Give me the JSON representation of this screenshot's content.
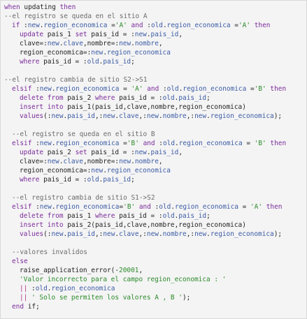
{
  "editor": {
    "lines": [
      {
        "indent": 0,
        "tokens": [
          [
            "kw",
            "when"
          ],
          [
            "tx",
            " updating "
          ],
          [
            "kw",
            "then"
          ]
        ]
      },
      {
        "indent": 0,
        "tokens": [
          [
            "cm",
            "--el registro se queda en el sitio A"
          ]
        ]
      },
      {
        "indent": 1,
        "tokens": [
          [
            "kw",
            "if"
          ],
          [
            "tx",
            " :"
          ],
          [
            "id",
            "new"
          ],
          [
            "tx",
            "."
          ],
          [
            "id",
            "region_economica"
          ],
          [
            "tx",
            " ="
          ],
          [
            "st",
            "'A'"
          ],
          [
            "tx",
            " "
          ],
          [
            "kw",
            "and"
          ],
          [
            "tx",
            " :"
          ],
          [
            "id",
            "old"
          ],
          [
            "tx",
            "."
          ],
          [
            "id",
            "region_economica"
          ],
          [
            "tx",
            " ="
          ],
          [
            "st",
            "'A'"
          ],
          [
            "tx",
            " "
          ],
          [
            "kw",
            "then"
          ]
        ]
      },
      {
        "indent": 2,
        "tokens": [
          [
            "kw",
            "update"
          ],
          [
            "tx",
            " pais_1 "
          ],
          [
            "kw",
            "set"
          ],
          [
            "tx",
            " pais_id = :"
          ],
          [
            "id",
            "new"
          ],
          [
            "tx",
            "."
          ],
          [
            "id",
            "pais_id"
          ],
          [
            "tx",
            ","
          ]
        ]
      },
      {
        "indent": 2,
        "tokens": [
          [
            "tx",
            "clave=:"
          ],
          [
            "id",
            "new"
          ],
          [
            "tx",
            "."
          ],
          [
            "id",
            "clave"
          ],
          [
            "tx",
            ",nombre=:"
          ],
          [
            "id",
            "new"
          ],
          [
            "tx",
            "."
          ],
          [
            "id",
            "nombre"
          ],
          [
            "tx",
            ","
          ]
        ]
      },
      {
        "indent": 2,
        "tokens": [
          [
            "tx",
            "region_economica=:"
          ],
          [
            "id",
            "new"
          ],
          [
            "tx",
            "."
          ],
          [
            "id",
            "region_economica"
          ]
        ]
      },
      {
        "indent": 2,
        "tokens": [
          [
            "kw",
            "where"
          ],
          [
            "tx",
            " pais_id = :"
          ],
          [
            "id",
            "old"
          ],
          [
            "tx",
            "."
          ],
          [
            "id",
            "pais_id"
          ],
          [
            "tx",
            ";"
          ]
        ]
      },
      {
        "indent": 0,
        "tokens": [
          [
            "tx",
            ""
          ]
        ]
      },
      {
        "indent": 0,
        "tokens": [
          [
            "cm",
            "--el registro cambia de sitio S2->S1"
          ]
        ]
      },
      {
        "indent": 1,
        "tokens": [
          [
            "kw",
            "elsif"
          ],
          [
            "tx",
            " :"
          ],
          [
            "id",
            "new"
          ],
          [
            "tx",
            "."
          ],
          [
            "id",
            "region_economica"
          ],
          [
            "tx",
            " = "
          ],
          [
            "st",
            "'A'"
          ],
          [
            "tx",
            " "
          ],
          [
            "kw",
            "and"
          ],
          [
            "tx",
            " :"
          ],
          [
            "id",
            "old"
          ],
          [
            "tx",
            "."
          ],
          [
            "id",
            "region_economica"
          ],
          [
            "tx",
            " ="
          ],
          [
            "st",
            "'B'"
          ],
          [
            "tx",
            " "
          ],
          [
            "kw",
            "then"
          ]
        ]
      },
      {
        "indent": 2,
        "tokens": [
          [
            "kw",
            "delete"
          ],
          [
            "tx",
            " "
          ],
          [
            "kw",
            "from"
          ],
          [
            "tx",
            " pais_2 "
          ],
          [
            "kw",
            "where"
          ],
          [
            "tx",
            " pais_id = :"
          ],
          [
            "id",
            "old"
          ],
          [
            "tx",
            "."
          ],
          [
            "id",
            "pais_id"
          ],
          [
            "tx",
            ";"
          ]
        ]
      },
      {
        "indent": 2,
        "tokens": [
          [
            "kw",
            "insert"
          ],
          [
            "tx",
            " "
          ],
          [
            "kw",
            "into"
          ],
          [
            "tx",
            " pais_1(pais_id,clave,nombre,region_economica)"
          ]
        ]
      },
      {
        "indent": 2,
        "tokens": [
          [
            "kw",
            "values"
          ],
          [
            "tx",
            "(:"
          ],
          [
            "id",
            "new"
          ],
          [
            "tx",
            "."
          ],
          [
            "id",
            "pais_id"
          ],
          [
            "tx",
            ",:"
          ],
          [
            "id",
            "new"
          ],
          [
            "tx",
            "."
          ],
          [
            "id",
            "clave"
          ],
          [
            "tx",
            ",:"
          ],
          [
            "id",
            "new"
          ],
          [
            "tx",
            "."
          ],
          [
            "id",
            "nombre"
          ],
          [
            "tx",
            ",:"
          ],
          [
            "id",
            "new"
          ],
          [
            "tx",
            "."
          ],
          [
            "id",
            "region_economica"
          ],
          [
            "tx",
            ");"
          ]
        ]
      },
      {
        "indent": 0,
        "tokens": [
          [
            "tx",
            ""
          ]
        ]
      },
      {
        "indent": 1,
        "tokens": [
          [
            "cm",
            "--el registro se queda en el sitio B"
          ]
        ]
      },
      {
        "indent": 1,
        "tokens": [
          [
            "kw",
            "elsif"
          ],
          [
            "tx",
            " :"
          ],
          [
            "id",
            "new"
          ],
          [
            "tx",
            "."
          ],
          [
            "id",
            "region_economica"
          ],
          [
            "tx",
            " ="
          ],
          [
            "st",
            "'B'"
          ],
          [
            "tx",
            " "
          ],
          [
            "kw",
            "and"
          ],
          [
            "tx",
            " :"
          ],
          [
            "id",
            "old"
          ],
          [
            "tx",
            "."
          ],
          [
            "id",
            "region_economica"
          ],
          [
            "tx",
            " = "
          ],
          [
            "st",
            "'B'"
          ],
          [
            "tx",
            " "
          ],
          [
            "kw",
            "then"
          ]
        ]
      },
      {
        "indent": 2,
        "tokens": [
          [
            "kw",
            "update"
          ],
          [
            "tx",
            " pais_2 "
          ],
          [
            "kw",
            "set"
          ],
          [
            "tx",
            " pais_id = :"
          ],
          [
            "id",
            "new"
          ],
          [
            "tx",
            "."
          ],
          [
            "id",
            "pais_id"
          ],
          [
            "tx",
            ","
          ]
        ]
      },
      {
        "indent": 2,
        "tokens": [
          [
            "tx",
            "clave=:"
          ],
          [
            "id",
            "new"
          ],
          [
            "tx",
            "."
          ],
          [
            "id",
            "clave"
          ],
          [
            "tx",
            ",nombre=:"
          ],
          [
            "id",
            "new"
          ],
          [
            "tx",
            "."
          ],
          [
            "id",
            "nombre"
          ],
          [
            "tx",
            ","
          ]
        ]
      },
      {
        "indent": 2,
        "tokens": [
          [
            "tx",
            "region_economica=:"
          ],
          [
            "id",
            "new"
          ],
          [
            "tx",
            "."
          ],
          [
            "id",
            "region_economica"
          ]
        ]
      },
      {
        "indent": 2,
        "tokens": [
          [
            "kw",
            "where"
          ],
          [
            "tx",
            " pais_id = :"
          ],
          [
            "id",
            "old"
          ],
          [
            "tx",
            "."
          ],
          [
            "id",
            "pais_id"
          ],
          [
            "tx",
            ";"
          ]
        ]
      },
      {
        "indent": 0,
        "tokens": [
          [
            "tx",
            ""
          ]
        ]
      },
      {
        "indent": 1,
        "tokens": [
          [
            "cm",
            "--el registro cambia de sitio S1->S2"
          ]
        ]
      },
      {
        "indent": 1,
        "tokens": [
          [
            "kw",
            "elsif"
          ],
          [
            "tx",
            " :"
          ],
          [
            "id",
            "new"
          ],
          [
            "tx",
            "."
          ],
          [
            "id",
            "region_economica"
          ],
          [
            "tx",
            "="
          ],
          [
            "st",
            "'B'"
          ],
          [
            "tx",
            " "
          ],
          [
            "kw",
            "and"
          ],
          [
            "tx",
            " :"
          ],
          [
            "id",
            "old"
          ],
          [
            "tx",
            "."
          ],
          [
            "id",
            "region_economica"
          ],
          [
            "tx",
            " = "
          ],
          [
            "st",
            "'A'"
          ],
          [
            "tx",
            " "
          ],
          [
            "kw",
            "then"
          ]
        ]
      },
      {
        "indent": 2,
        "tokens": [
          [
            "kw",
            "delete"
          ],
          [
            "tx",
            " "
          ],
          [
            "kw",
            "from"
          ],
          [
            "tx",
            " pais_1 "
          ],
          [
            "kw",
            "where"
          ],
          [
            "tx",
            " pais_id = :"
          ],
          [
            "id",
            "old"
          ],
          [
            "tx",
            "."
          ],
          [
            "id",
            "pais_id"
          ],
          [
            "tx",
            ";"
          ]
        ]
      },
      {
        "indent": 2,
        "tokens": [
          [
            "kw",
            "insert"
          ],
          [
            "tx",
            " "
          ],
          [
            "kw",
            "into"
          ],
          [
            "tx",
            " pais_2(pais_id,clave,nombre,region_economica)"
          ]
        ]
      },
      {
        "indent": 2,
        "tokens": [
          [
            "kw",
            "values"
          ],
          [
            "tx",
            "(:"
          ],
          [
            "id",
            "new"
          ],
          [
            "tx",
            "."
          ],
          [
            "id",
            "pais_id"
          ],
          [
            "tx",
            ",:"
          ],
          [
            "id",
            "new"
          ],
          [
            "tx",
            "."
          ],
          [
            "id",
            "clave"
          ],
          [
            "tx",
            ",:"
          ],
          [
            "id",
            "new"
          ],
          [
            "tx",
            "."
          ],
          [
            "id",
            "nombre"
          ],
          [
            "tx",
            ",:"
          ],
          [
            "id",
            "new"
          ],
          [
            "tx",
            "."
          ],
          [
            "id",
            "region_economica"
          ],
          [
            "tx",
            ");"
          ]
        ]
      },
      {
        "indent": 0,
        "tokens": [
          [
            "tx",
            ""
          ]
        ]
      },
      {
        "indent": 1,
        "tokens": [
          [
            "cm",
            "--valores invalidos"
          ]
        ]
      },
      {
        "indent": 1,
        "tokens": [
          [
            "kw",
            "else"
          ]
        ]
      },
      {
        "indent": 2,
        "tokens": [
          [
            "tx",
            "raise_application_error(-"
          ],
          [
            "nm",
            "20001"
          ],
          [
            "tx",
            ","
          ]
        ]
      },
      {
        "indent": 2,
        "tokens": [
          [
            "st",
            "'Valor incorrecto para el campo region_economica : '"
          ]
        ]
      },
      {
        "indent": 2,
        "tokens": [
          [
            "mg",
            "||"
          ],
          [
            "tx",
            " :"
          ],
          [
            "id",
            "old"
          ],
          [
            "tx",
            "."
          ],
          [
            "id",
            "region_economica"
          ]
        ]
      },
      {
        "indent": 2,
        "tokens": [
          [
            "mg",
            "||"
          ],
          [
            "tx",
            " "
          ],
          [
            "st",
            "' Solo se permiten los valores A , B '"
          ],
          [
            "tx",
            ");"
          ]
        ]
      },
      {
        "indent": 1,
        "tokens": [
          [
            "kw",
            "end"
          ],
          [
            "tx",
            " if;"
          ]
        ]
      }
    ]
  }
}
